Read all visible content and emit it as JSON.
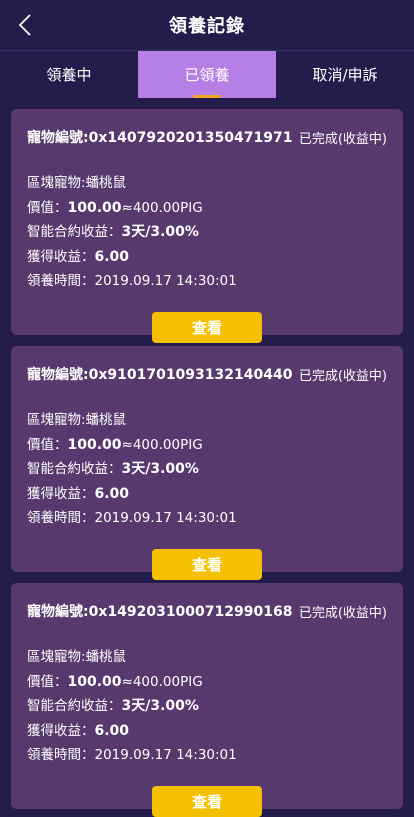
{
  "header": {
    "title": "領養記錄",
    "back_icon": "chevron-left-icon"
  },
  "tabs": [
    {
      "label": "領養中",
      "active": false
    },
    {
      "label": "已領養",
      "active": true
    },
    {
      "label": "取消/申訴",
      "active": false
    }
  ],
  "records": [
    {
      "pet_id": "寵物編號:0x1407920201350471971",
      "status": "已完成(收益中)",
      "pet_label": "區塊寵物:",
      "pet_value": "蟠桃鼠",
      "price_label": "價值：",
      "price_bold": "100.00",
      "price_rest": "≈400.00PIG",
      "contract_label": "智能合約收益：",
      "contract_value": "3天/3.00%",
      "earn_label": "獲得收益：",
      "earn_value": "6.00",
      "time_label": "領養時間：",
      "time_value": "2019.09.17 14:30:01",
      "button": "查看"
    },
    {
      "pet_id": "寵物編號:0x9101701093132140440",
      "status": "已完成(收益中)",
      "pet_label": "區塊寵物:",
      "pet_value": "蟠桃鼠",
      "price_label": "價值：",
      "price_bold": "100.00",
      "price_rest": "≈400.00PIG",
      "contract_label": "智能合約收益：",
      "contract_value": "3天/3.00%",
      "earn_label": "獲得收益：",
      "earn_value": "6.00",
      "time_label": "領養時間：",
      "time_value": "2019.09.17 14:30:01",
      "button": "查看"
    },
    {
      "pet_id": "寵物編號:0x1492031000712990168",
      "status": "已完成(收益中)",
      "pet_label": "區塊寵物:",
      "pet_value": "蟠桃鼠",
      "price_label": "價值：",
      "price_bold": "100.00",
      "price_rest": "≈400.00PIG",
      "contract_label": "智能合約收益：",
      "contract_value": "3天/3.00%",
      "earn_label": "獲得收益：",
      "earn_value": "6.00",
      "time_label": "領養時間：",
      "time_value": "2019.09.17 14:30:01",
      "button": "查看"
    }
  ],
  "colors": {
    "background": "#241c4b",
    "active_tab": "#b57fe6",
    "card": "#57396e",
    "button": "#f5c000",
    "tab_indicator": "#f5a623"
  }
}
